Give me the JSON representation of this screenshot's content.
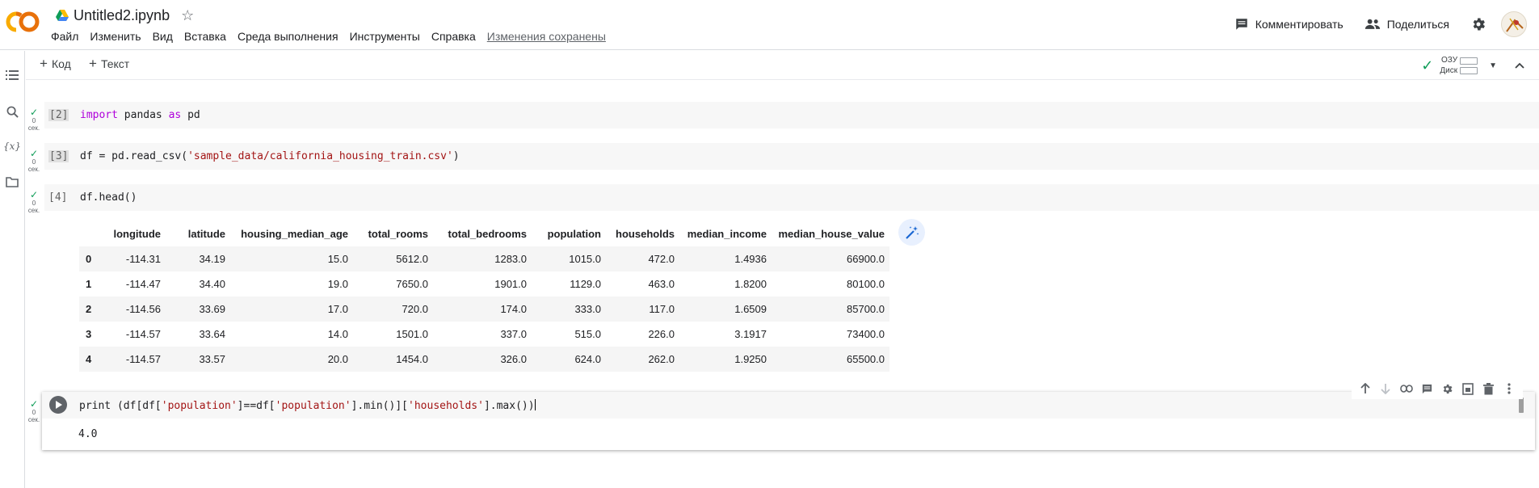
{
  "header": {
    "doc_title": "Untitled2.ipynb",
    "menu": [
      "Файл",
      "Изменить",
      "Вид",
      "Вставка",
      "Среда выполнения",
      "Инструменты",
      "Справка"
    ],
    "save_status": "Изменения сохранены",
    "comment_label": "Комментировать",
    "share_label": "Поделиться"
  },
  "toolbar": {
    "add_code": "Код",
    "add_text": "Текст",
    "ram_label": "ОЗУ",
    "disk_label": "Диск"
  },
  "cells": [
    {
      "count": "[2]",
      "time": "0",
      "unit": "сек."
    },
    {
      "count": "[3]",
      "time": "0",
      "unit": "сек."
    },
    {
      "count": "[4]",
      "time": "0",
      "unit": "сек."
    },
    {
      "count": "",
      "time": "0",
      "unit": "сек."
    }
  ],
  "code": {
    "c2_kw1": "import",
    "c2_mod": " pandas ",
    "c2_kw2": "as",
    "c2_alias": " pd",
    "c3_pre": "df = pd.read_csv(",
    "c3_str": "'sample_data/california_housing_train.csv'",
    "c3_post": ")",
    "c4_code": "df.head()",
    "c5_pre": "print (df[df[",
    "c5_str1": "'population'",
    "c5_mid1": "]==df[",
    "c5_str2": "'population'",
    "c5_mid2": "].min()][",
    "c5_str3": "'households'",
    "c5_post": "].max())"
  },
  "output_text": "4.0",
  "dataframe": {
    "columns": [
      "",
      "longitude",
      "latitude",
      "housing_median_age",
      "total_rooms",
      "total_bedrooms",
      "population",
      "households",
      "median_income",
      "median_house_value"
    ],
    "rows": [
      [
        "0",
        "-114.31",
        "34.19",
        "15.0",
        "5612.0",
        "1283.0",
        "1015.0",
        "472.0",
        "1.4936",
        "66900.0"
      ],
      [
        "1",
        "-114.47",
        "34.40",
        "19.0",
        "7650.0",
        "1901.0",
        "1129.0",
        "463.0",
        "1.8200",
        "80100.0"
      ],
      [
        "2",
        "-114.56",
        "33.69",
        "17.0",
        "720.0",
        "174.0",
        "333.0",
        "117.0",
        "1.6509",
        "85700.0"
      ],
      [
        "3",
        "-114.57",
        "33.64",
        "14.0",
        "1501.0",
        "337.0",
        "515.0",
        "226.0",
        "3.1917",
        "73400.0"
      ],
      [
        "4",
        "-114.57",
        "33.57",
        "20.0",
        "1454.0",
        "326.0",
        "624.0",
        "262.0",
        "1.9250",
        "65500.0"
      ]
    ]
  },
  "icons": {
    "logo": "colab-logo",
    "left_rail": [
      "toc-icon",
      "search-icon",
      "variables-icon",
      "folder-icon"
    ],
    "cell_toolbar": [
      "arrow-up-icon",
      "arrow-down-icon",
      "link-icon",
      "comment-icon",
      "gear-icon",
      "mirror-cell-icon",
      "delete-icon",
      "more-vert-icon"
    ]
  },
  "colors": {
    "accent_orange": "#f9ab00",
    "check_green": "#0f9d58",
    "string_red": "#a31515",
    "keyword_purple": "#af00db"
  }
}
